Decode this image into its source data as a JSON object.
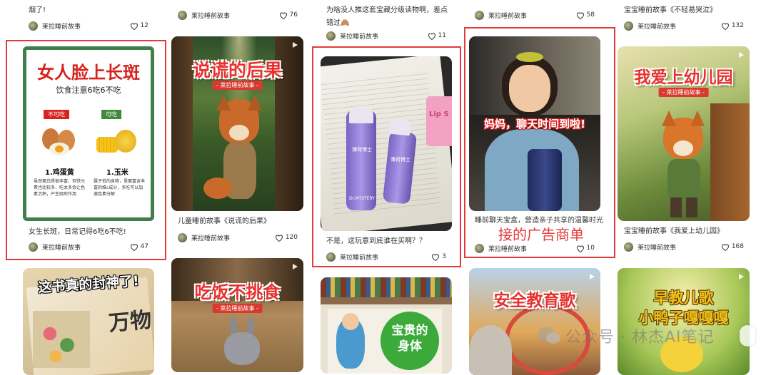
{
  "top_row": [
    {
      "title": "烟了!",
      "author": "莱拉睡前故事",
      "likes": "12"
    },
    {
      "title": "",
      "author": "莱拉睡前故事",
      "likes": "76"
    },
    {
      "title": "为啥没人推这套宝藏分级读物啊，差点错过🙈",
      "author": "莱拉睡前故事",
      "likes": "11"
    },
    {
      "title": "",
      "author": "莱拉睡前故事",
      "likes": "58"
    },
    {
      "title": "宝宝睡前故事《不轻易哭泣》",
      "author": "莱拉睡前故事",
      "likes": "132"
    }
  ],
  "middle_row": [
    {
      "title": "女生长斑，日常记得6吃6不吃!",
      "author": "莱拉睡前故事",
      "likes": "47"
    },
    {
      "title": "儿童睡前故事《说谎的后果》",
      "author": "莱拉睡前故事",
      "likes": "120"
    },
    {
      "title": "不是，这玩意到底谁在买啊？？",
      "author": "莱拉睡前故事",
      "likes": "3"
    },
    {
      "title": "睡前聊天宝盒，营造亲子共享的温馨时光",
      "author": "莱拉睡前故事",
      "likes": "10"
    },
    {
      "title": "宝宝睡前故事《我爱上幼儿园》",
      "author": "莱拉睡前故事",
      "likes": "168"
    }
  ],
  "card_texts": {
    "diet_card": {
      "headline": "女人脸上长斑",
      "subhead": "饮食注意6吃6不吃",
      "tag_no": "不可吃",
      "tag_yes": "可吃",
      "item1": "1.鸡蛋黄",
      "item2": "1.玉米",
      "desc1": "虽然蛋白质很丰富，但铁元素也比较多，吃太多会让色素沉积，产生吸附作用",
      "desc2": "属于低的食物，里面富含丰富的维c成分，多吃可以加速色素分解"
    },
    "lie_card": {
      "headline": "说谎的后果",
      "tag": "- 莱拉睡前故事 -"
    },
    "product_card": {
      "label1": "薄荷博士",
      "label2": "薄荷博士",
      "brand": "Dr.MYSTERY",
      "pink_card": "Lip S"
    },
    "girl_card": {
      "headline": "妈妈，聊天时间到啦!"
    },
    "kindergarten_card": {
      "headline": "我爱上幼儿园",
      "tag": "- 莱拉睡前故事 -"
    },
    "book_card": {
      "headline": "这书真的封神了!",
      "book_text": "万物"
    },
    "eat_card": {
      "headline": "吃饭不挑食",
      "tag": "- 莱拉睡前故事 -"
    },
    "body_card": {
      "headline": "宝贵的身体"
    },
    "safety_card": {
      "headline": "安全教育歌"
    },
    "duck_card": {
      "headline1": "早教儿歌",
      "headline2": "小鸭子嘎嘎嘎"
    }
  },
  "annotation": "接的广告商单",
  "watermark": "公众号 · 林杰AI笔记",
  "colors": {
    "highlight_red": "#e53a3a",
    "title_red": "#e8312f"
  }
}
